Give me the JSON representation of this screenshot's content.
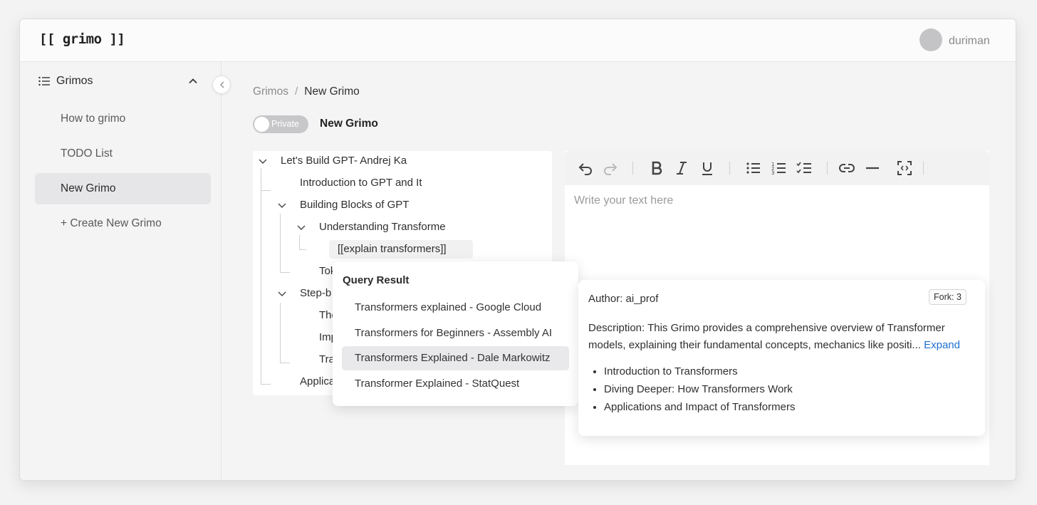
{
  "app": {
    "logo": "[[ grimo ]]",
    "username": "duriman"
  },
  "sidebar": {
    "section_title": "Grimos",
    "items": [
      {
        "label": "How to grimo"
      },
      {
        "label": "TODO List"
      },
      {
        "label": "New Grimo",
        "active": true
      },
      {
        "label": "+ Create New Grimo"
      }
    ]
  },
  "breadcrumb": {
    "root": "Grimos",
    "separator": "/",
    "current": "New Grimo"
  },
  "visibility_toggle": {
    "label": "Private",
    "on": false
  },
  "document": {
    "title": "New Grimo"
  },
  "tree": {
    "nodes": [
      {
        "label": "Let's Build GPT- Andrej Ka"
      },
      {
        "label": "Introduction to GPT and It"
      },
      {
        "label": "Building Blocks of GPT"
      },
      {
        "label": "Understanding Transforme"
      },
      {
        "label": "Tok"
      },
      {
        "label": "Step-b"
      },
      {
        "label": "The"
      },
      {
        "label": "Imp"
      },
      {
        "label": "Tra"
      },
      {
        "label": "Applica"
      }
    ],
    "query_input_value": "[[explain transformers]]"
  },
  "editor": {
    "placeholder": "Write your text here",
    "toolbar": [
      "undo-icon",
      "redo-icon",
      "bold-icon",
      "italic-icon",
      "underline-icon",
      "bullet-list-icon",
      "numbered-list-icon",
      "checklist-icon",
      "link-icon",
      "horizontal-rule-icon",
      "fullscreen-icon"
    ]
  },
  "query_popup": {
    "title": "Query Result",
    "results": [
      {
        "label": "Transformers explained - Google Cloud"
      },
      {
        "label": "Transformers for Beginners - Assembly AI"
      },
      {
        "label": "Transformers Explained - Dale Markowitz",
        "highlighted": true
      },
      {
        "label": "Transformer Explained - StatQuest"
      }
    ]
  },
  "detail_popup": {
    "author": "Author: ai_prof",
    "fork": "Fork: 3",
    "description": "Description: This Grimo provides a comprehensive overview of Transformer models, explaining their fundamental concepts, mechanics like positi...",
    "expand_label": "Expand",
    "outline": [
      "Introduction to Transformers",
      "Diving Deeper: How Transformers Work",
      "Applications and Impact of Transformers"
    ]
  }
}
